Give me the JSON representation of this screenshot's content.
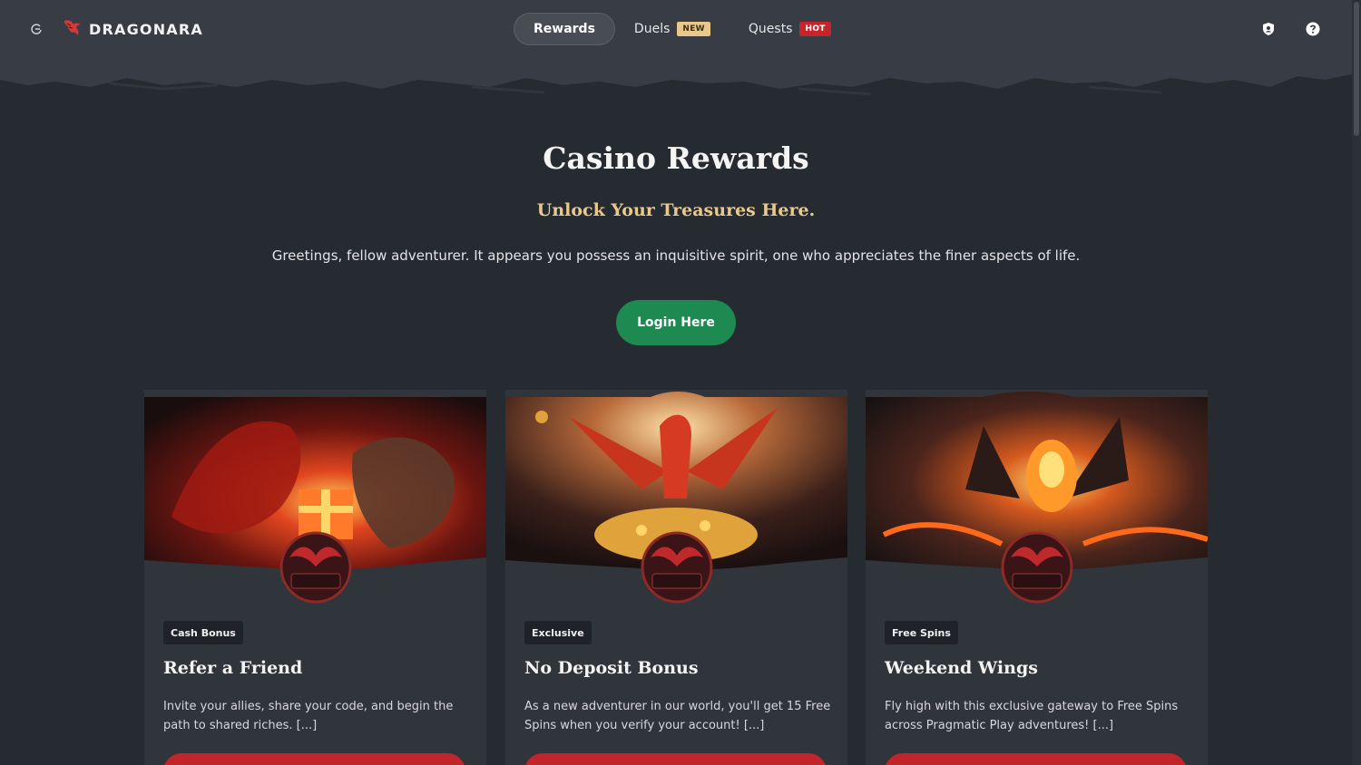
{
  "header": {
    "back_icon": "refresh-back-icon",
    "logo_icon": "dragon-icon",
    "logo_text": "DRAGONARA",
    "nav": [
      {
        "label": "Rewards",
        "active": true
      },
      {
        "label": "Duels",
        "badge": "NEW"
      },
      {
        "label": "Quests",
        "badge": "HOT"
      }
    ],
    "shield_icon": "shield-icon",
    "help_icon": "help-icon"
  },
  "hero": {
    "title": "Casino Rewards",
    "subtitle": "Unlock Your Treasures Here.",
    "description": "Greetings, fellow adventurer. It appears you possess an inquisitive spirit, one who appreciates the finer aspects of life.",
    "login_label": "Login Here"
  },
  "cards": [
    {
      "tag": "Cash Bonus",
      "title": "Refer a Friend",
      "description": "Invite your allies, share your code, and begin the path to shared riches. [...]"
    },
    {
      "tag": "Exclusive",
      "title": "No Deposit Bonus",
      "description": "As a new adventurer in our world, you'll get 15 Free Spins when you verify your account! [...]"
    },
    {
      "tag": "Free Spins",
      "title": "Weekend Wings",
      "description": "Fly high with this exclusive gateway to Free Spins across Pragmatic Play adventures! [...]"
    }
  ],
  "colors": {
    "background": "#262a31",
    "header": "#383c44",
    "accent_gold": "#e9c98b",
    "login_green": "#1d8a52",
    "card_button_red": "#c2242b"
  }
}
